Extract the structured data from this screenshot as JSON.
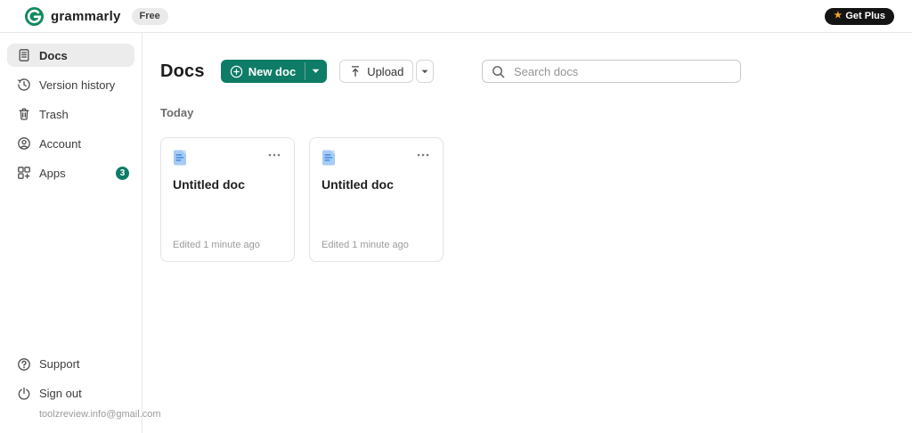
{
  "brand": {
    "wordmark": "grammarly",
    "plan_badge": "Free",
    "get_plus_label": "Get Plus"
  },
  "icons": {
    "star": "★"
  },
  "colors": {
    "brand_green": "#128A5E",
    "accent_green": "#0E7C66",
    "get_plus_black": "#141414",
    "star_gold": "#F5A623",
    "doc_icon_blue": "#A6CBF4",
    "doc_icon_dark_blue": "#4E92E6"
  },
  "sidebar": {
    "items": [
      {
        "label": "Docs",
        "active": true
      },
      {
        "label": "Version history",
        "active": false
      },
      {
        "label": "Trash",
        "active": false
      },
      {
        "label": "Account",
        "active": false
      },
      {
        "label": "Apps",
        "active": false,
        "badge": "3"
      }
    ],
    "footer": {
      "support_label": "Support",
      "sign_out_label": "Sign out",
      "account_email": "toolzreview.info@gmail.com"
    }
  },
  "main": {
    "title": "Docs",
    "new_doc_label": "New doc",
    "upload_label": "Upload",
    "search_placeholder": "Search docs",
    "section_label": "Today",
    "docs": [
      {
        "title": "Untitled doc",
        "edited": "Edited 1 minute ago"
      },
      {
        "title": "Untitled doc",
        "edited": "Edited 1 minute ago"
      }
    ]
  }
}
